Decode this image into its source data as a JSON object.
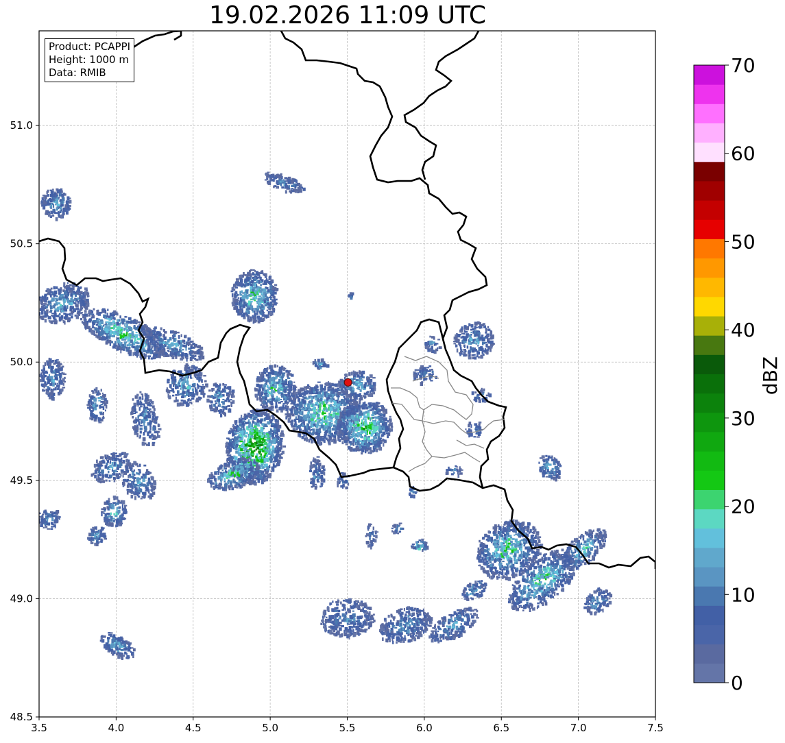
{
  "title": "19.02.2026 11:09 UTC",
  "info": {
    "product": "Product: PCAPPI",
    "height": "Height: 1000 m",
    "data": "Data: RMIB"
  },
  "axes": {
    "x_ticks": [
      "3.5",
      "4.0",
      "4.5",
      "5.0",
      "5.5",
      "6.0",
      "6.5",
      "7.0",
      "7.5"
    ],
    "y_ticks": [
      "51.0",
      "50.5",
      "50.0",
      "49.5",
      "49.0",
      "48.5"
    ],
    "xlim": [
      3.5,
      7.5
    ],
    "ylim": [
      48.5,
      51.4
    ],
    "grid": true
  },
  "radar_site": {
    "lon": 5.505,
    "lat": 49.914,
    "color": "#e01010"
  },
  "colorbar": {
    "label": "dBZ",
    "min": 0,
    "max": 70,
    "step": 2.5,
    "ticks": [
      "0",
      "10",
      "20",
      "30",
      "40",
      "50",
      "60",
      "70"
    ],
    "colors": [
      "#6475a8",
      "#5a6aa0",
      "#4a65a8",
      "#4260a6",
      "#4a78b0",
      "#5a95c2",
      "#60a8cc",
      "#62c0dc",
      "#5cd8c2",
      "#3cd470",
      "#14c814",
      "#12ba12",
      "#10a810",
      "#0e960e",
      "#0c820c",
      "#0a700a",
      "#0a5a0a",
      "#487810",
      "#a8b008",
      "#ffd800",
      "#ffb800",
      "#ff9800",
      "#ff7800",
      "#e60000",
      "#c40000",
      "#a00000",
      "#7a0000",
      "#ffe0ff",
      "#ffb0ff",
      "#ff70ff",
      "#ee33ee",
      "#cc11dd"
    ]
  },
  "echo_intensity_scale": {
    "min": 0,
    "max": 35
  }
}
